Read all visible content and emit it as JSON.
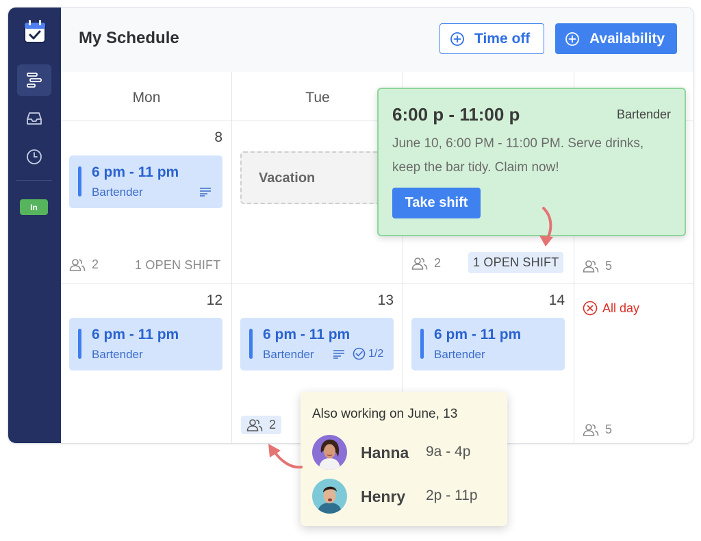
{
  "app": {
    "title": "My Schedule"
  },
  "sidebar": {
    "items": [
      {
        "name": "schedule",
        "icon": "schedule-bars-icon",
        "active": true
      },
      {
        "name": "inbox",
        "icon": "inbox-icon",
        "active": false
      },
      {
        "name": "timeclock",
        "icon": "clock-icon",
        "active": false
      }
    ],
    "badge": "In"
  },
  "header": {
    "timeoff_label": "Time off",
    "availability_label": "Availability"
  },
  "days": [
    "Mon",
    "Tue"
  ],
  "week1": {
    "mon": {
      "date": "8",
      "shift_time": "6 pm - 11 pm",
      "shift_role": "Bartender",
      "people": "2",
      "open": "1 OPEN SHIFT"
    },
    "tue": {
      "vacation": "Vacation"
    },
    "wed": {
      "people": "2",
      "open": "1 OPEN SHIFT"
    },
    "thu": {
      "people": "5"
    }
  },
  "week2": {
    "mon": {
      "date": "12",
      "shift_time": "6 pm - 11 pm",
      "shift_role": "Bartender"
    },
    "tue": {
      "date": "13",
      "shift_time": "6 pm - 11 pm",
      "shift_role": "Bartender",
      "check": "1/2",
      "people": "2"
    },
    "wed": {
      "date": "14",
      "shift_time": "6 pm - 11 pm",
      "shift_role": "Bartender"
    },
    "thu": {
      "allday": "All day",
      "people": "5"
    }
  },
  "popover": {
    "time": "6:00 p - 11:00 p",
    "role": "Bartender",
    "description": "June 10, 6:00 PM - 11:00 PM. Serve drinks, keep the bar tidy. Claim now!",
    "cta": "Take shift"
  },
  "tooltip": {
    "title": "Also working on June, 13",
    "people": [
      {
        "name": "Hanna",
        "hours": "9a - 4p"
      },
      {
        "name": "Henry",
        "hours": "2p - 11p"
      }
    ]
  },
  "colors": {
    "sidebar": "#233061",
    "accent": "#3f82ef",
    "shift_bg": "#d4e4fd",
    "popover_bg": "#d3f1d8",
    "tooltip_bg": "#fbf9e6",
    "alert": "#d93025",
    "status_in": "#56b45c"
  }
}
